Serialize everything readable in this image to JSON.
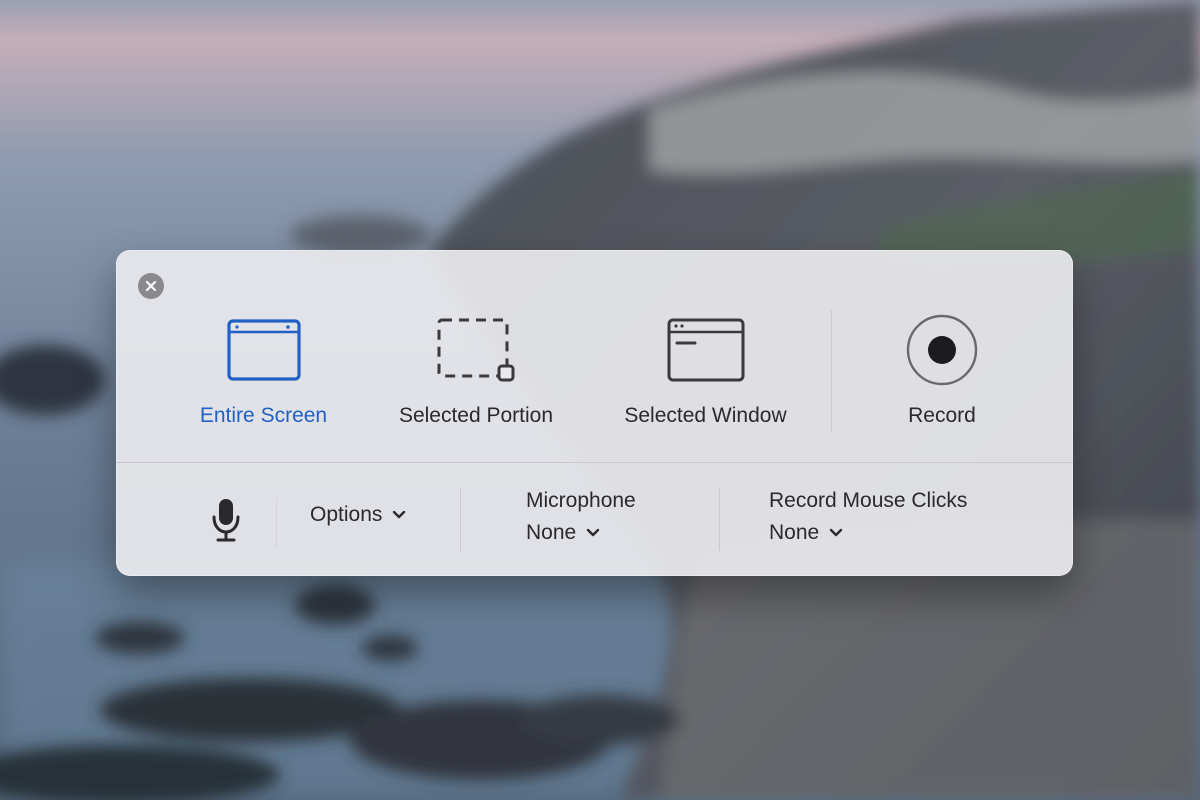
{
  "toolbar": {
    "capture_options": [
      {
        "label": "Entire Screen",
        "icon": "entire-screen-icon",
        "selected": true
      },
      {
        "label": "Selected Portion",
        "icon": "selected-portion-icon",
        "selected": false
      },
      {
        "label": "Selected Window",
        "icon": "selected-window-icon",
        "selected": false
      }
    ],
    "record": {
      "label": "Record",
      "icon": "record-icon"
    },
    "close": {
      "icon": "close-icon"
    },
    "microphone_toggle": {
      "icon": "microphone-icon"
    },
    "options": {
      "label": "Options",
      "icon": "chevron-down-icon"
    },
    "microphone": {
      "title": "Microphone",
      "value": "None",
      "icon": "chevron-down-icon"
    },
    "mouse_clicks": {
      "title": "Record Mouse Clicks",
      "value": "None",
      "icon": "chevron-down-icon"
    }
  },
  "colors": {
    "accent": "#2160c4",
    "text": "#2a2a2c",
    "panel_bg": "#eaeaee",
    "icon_dark": "#3a3a3c",
    "close_bg": "#8a8a8e"
  }
}
